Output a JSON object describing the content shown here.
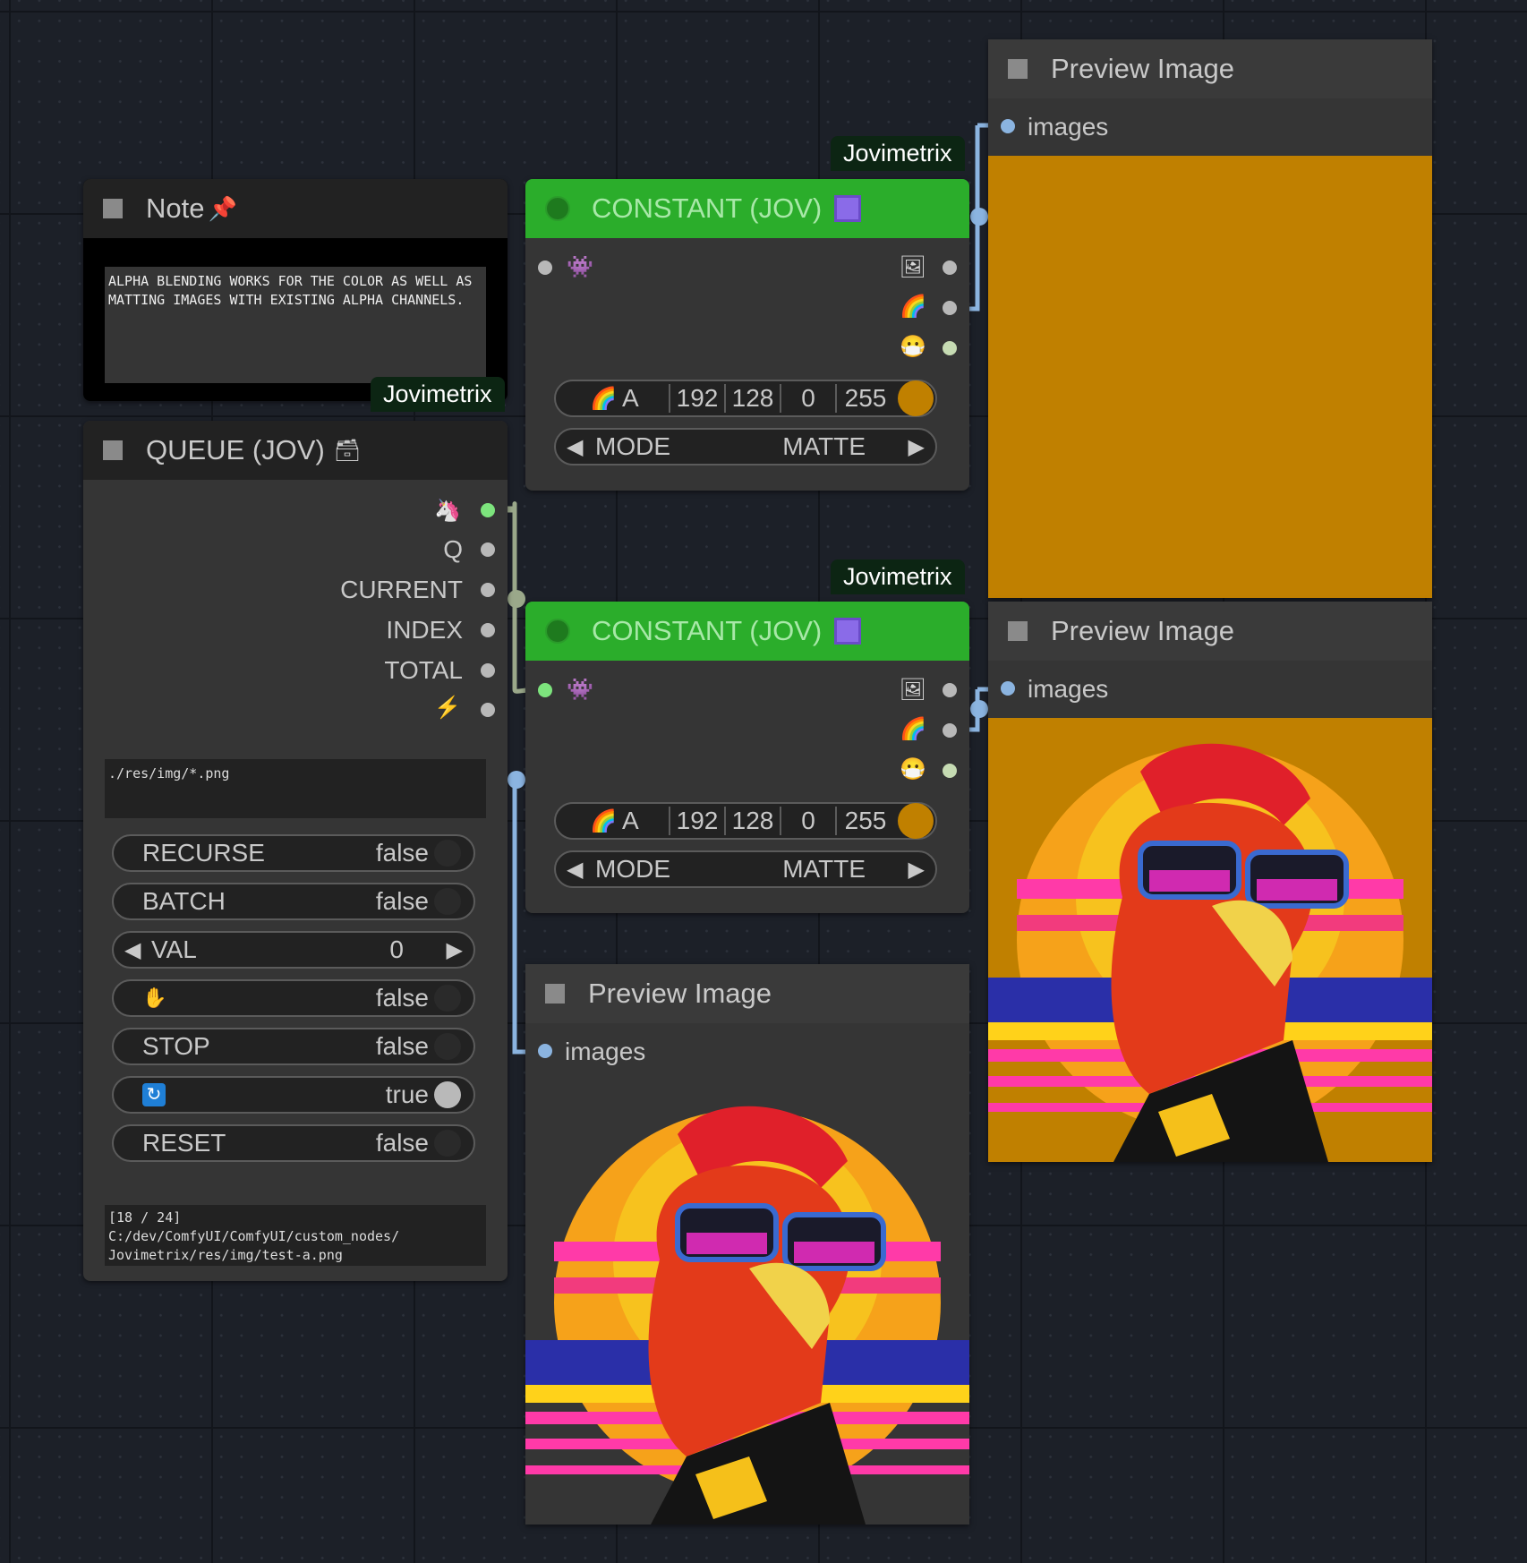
{
  "note": {
    "title": "Note",
    "pin_icon": "📌",
    "text": "ALPHA BLENDING WORKS FOR THE COLOR AS WELL AS MATTING IMAGES WITH EXISTING ALPHA CHANNELS.",
    "badge": "Jovimetrix"
  },
  "queue": {
    "title": "QUEUE (JOV)",
    "title_icon": "🗃",
    "outputs": [
      "Q",
      "CURRENT",
      "INDEX",
      "TOTAL"
    ],
    "path": "./res/img/*.png",
    "widgets": {
      "recurse_label": "RECURSE",
      "recurse_value": "false",
      "batch_label": "BATCH",
      "batch_value": "false",
      "val_label": "VAL",
      "val_value": "0",
      "hold_value": "false",
      "stop_label": "STOP",
      "stop_value": "false",
      "loop_value": "true",
      "reset_label": "RESET",
      "reset_value": "false"
    },
    "status": "[18 / 24]\nC:/dev/ComfyUI/ComfyUI/custom_nodes/\nJovimetrix/res/img/test-a.png"
  },
  "constant_top": {
    "badge": "Jovimetrix",
    "title": "CONSTANT (JOV)",
    "rgba_label": "A",
    "r": "192",
    "g": "128",
    "b": "0",
    "a": "255",
    "mode_label": "MODE",
    "mode_value": "MATTE"
  },
  "constant_bottom": {
    "badge": "Jovimetrix",
    "title": "CONSTANT (JOV)",
    "rgba_label": "A",
    "r": "192",
    "g": "128",
    "b": "0",
    "a": "255",
    "mode_label": "MODE",
    "mode_value": "MATTE"
  },
  "preview_top_right": {
    "title": "Preview Image",
    "input": "images"
  },
  "preview_mid_right": {
    "title": "Preview Image",
    "input": "images"
  },
  "preview_bottom": {
    "title": "Preview Image",
    "input": "images"
  },
  "colors": {
    "constant_header": "#2bad2b",
    "swatch": "#c08000",
    "background": "#1c2028"
  }
}
